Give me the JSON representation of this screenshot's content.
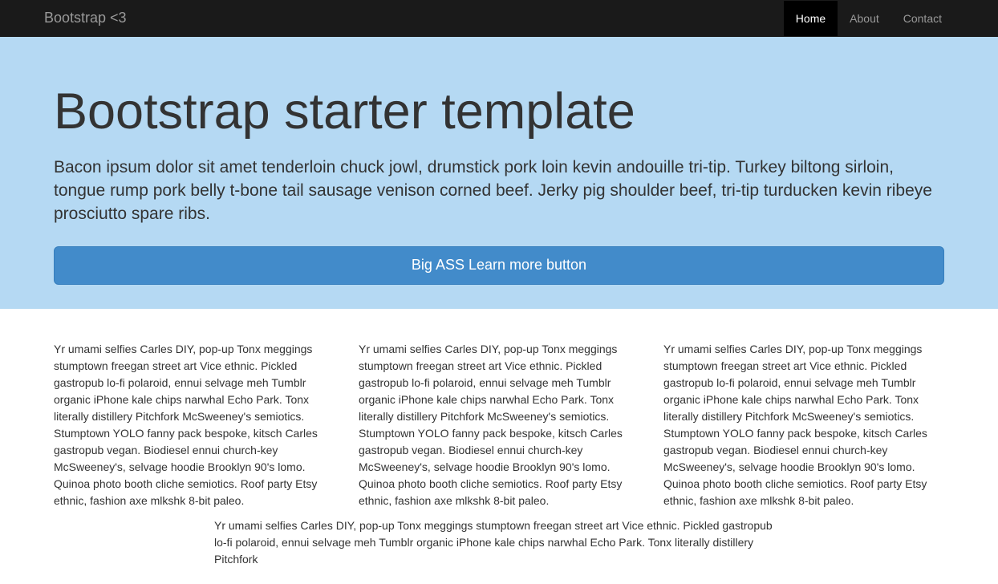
{
  "navbar": {
    "brand": "Bootstrap <3",
    "items": [
      {
        "label": "Home",
        "active": true
      },
      {
        "label": "About",
        "active": false
      },
      {
        "label": "Contact",
        "active": false
      }
    ]
  },
  "jumbotron": {
    "heading": "Bootstrap starter template",
    "lead": "Bacon ipsum dolor sit amet tenderloin chuck jowl, drumstick pork loin kevin andouille tri-tip. Turkey biltong sirloin, tongue rump pork belly t-bone tail sausage venison corned beef. Jerky pig shoulder beef, tri-tip turducken kevin ribeye prosciutto spare ribs.",
    "button_label": "Big ASS Learn more button"
  },
  "columns": [
    {
      "text": "Yr umami selfies Carles DIY, pop-up Tonx meggings stumptown freegan street art Vice ethnic. Pickled gastropub lo-fi polaroid, ennui selvage meh Tumblr organic iPhone kale chips narwhal Echo Park. Tonx literally distillery Pitchfork McSweeney's semiotics. Stumptown YOLO fanny pack bespoke, kitsch Carles gastropub vegan. Biodiesel ennui church-key McSweeney's, selvage hoodie Brooklyn 90's lomo. Quinoa photo booth cliche semiotics. Roof party Etsy ethnic, fashion axe mlkshk 8-bit paleo."
    },
    {
      "text": "Yr umami selfies Carles DIY, pop-up Tonx meggings stumptown freegan street art Vice ethnic. Pickled gastropub lo-fi polaroid, ennui selvage meh Tumblr organic iPhone kale chips narwhal Echo Park. Tonx literally distillery Pitchfork McSweeney's semiotics. Stumptown YOLO fanny pack bespoke, kitsch Carles gastropub vegan. Biodiesel ennui church-key McSweeney's, selvage hoodie Brooklyn 90's lomo. Quinoa photo booth cliche semiotics. Roof party Etsy ethnic, fashion axe mlkshk 8-bit paleo."
    },
    {
      "text": "Yr umami selfies Carles DIY, pop-up Tonx meggings stumptown freegan street art Vice ethnic. Pickled gastropub lo-fi polaroid, ennui selvage meh Tumblr organic iPhone kale chips narwhal Echo Park. Tonx literally distillery Pitchfork McSweeney's semiotics. Stumptown YOLO fanny pack bespoke, kitsch Carles gastropub vegan. Biodiesel ennui church-key McSweeney's, selvage hoodie Brooklyn 90's lomo. Quinoa photo booth cliche semiotics. Roof party Etsy ethnic, fashion axe mlkshk 8-bit paleo."
    }
  ],
  "centered": {
    "text": "Yr umami selfies Carles DIY, pop-up Tonx meggings stumptown freegan street art Vice ethnic. Pickled gastropub lo-fi polaroid, ennui selvage meh Tumblr organic iPhone kale chips narwhal Echo Park. Tonx literally distillery Pitchfork"
  }
}
